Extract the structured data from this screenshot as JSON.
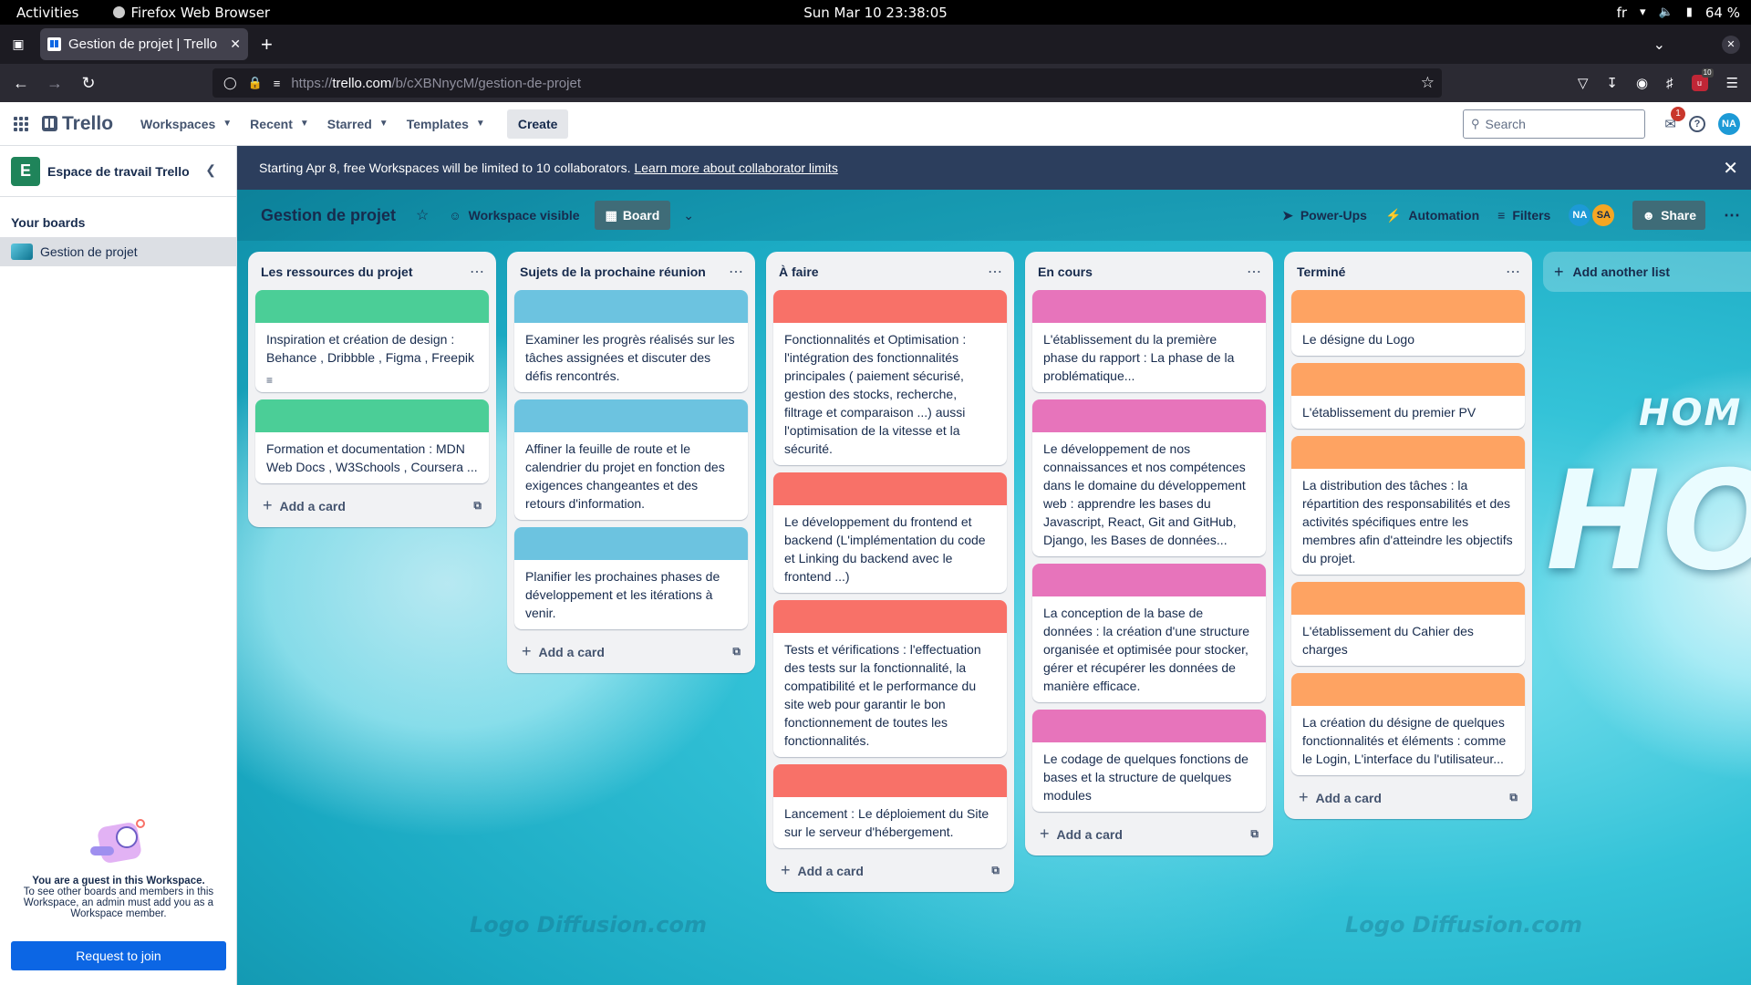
{
  "os": {
    "activities": "Activities",
    "app_name": "Firefox Web Browser",
    "clock": "Sun Mar 10  23:38:05",
    "lang": "fr",
    "battery": "64 %"
  },
  "browser": {
    "tab_title": "Gestion de projet | Trello",
    "url_prefix": "https://",
    "url_host": "trello.com",
    "url_path": "/b/cXBNnycM/gestion-de-projet",
    "ext_badge": "10"
  },
  "header": {
    "logo": "Trello",
    "menu": [
      "Workspaces",
      "Recent",
      "Starred",
      "Templates"
    ],
    "create": "Create",
    "search_placeholder": "Search",
    "notif_count": "1",
    "avatar": "NA"
  },
  "banner": {
    "text": "Starting Apr 8, free Workspaces will be limited to 10 collaborators.",
    "link": "Learn more about collaborator limits"
  },
  "sidebar": {
    "workspace_initial": "E",
    "workspace_name": "Espace de travail Trello",
    "your_boards": "Your boards",
    "boards": [
      "Gestion de projet"
    ],
    "guest_title": "You are a guest in this Workspace.",
    "guest_text": "To see other boards and members in this Workspace, an admin must add you as a Workspace member.",
    "join_button": "Request to join"
  },
  "board": {
    "title": "Gestion de projet",
    "visibility": "Workspace visible",
    "view": "Board",
    "powerups": "Power-Ups",
    "automation": "Automation",
    "filters": "Filters",
    "members": [
      "NA",
      "SA"
    ],
    "share": "Share",
    "add_card": "Add a card",
    "add_list": "Add another list",
    "background_text": [
      "HOM",
      "HO"
    ],
    "watermark": "Logo Diffusion.com",
    "colors": {
      "green": "#4bce97",
      "blue": "#6cc3e0",
      "red": "#f87168",
      "pink": "#e774bb",
      "orange": "#fea362"
    },
    "lists": [
      {
        "title": "Les ressources du projet",
        "cards": [
          {
            "cover": "#4bce97",
            "text": "Inspiration et création de design : Behance , Dribbble , Figma , Freepik",
            "has_description": true
          },
          {
            "cover": "#4bce97",
            "text": "Formation et documentation : MDN Web Docs , W3Schools , Coursera ..."
          }
        ]
      },
      {
        "title": "Sujets de la prochaine réunion",
        "cards": [
          {
            "cover": "#6cc3e0",
            "text": "Examiner les progrès réalisés sur les tâches assignées et discuter des défis rencontrés."
          },
          {
            "cover": "#6cc3e0",
            "text": "Affiner la feuille de route et le calendrier du projet en fonction des exigences changeantes et des retours d'information."
          },
          {
            "cover": "#6cc3e0",
            "text": "Planifier les prochaines phases de développement et les itérations à venir."
          }
        ]
      },
      {
        "title": "À faire",
        "cards": [
          {
            "cover": "#f87168",
            "text": "Fonctionnalités et Optimisation : l'intégration des fonctionnalités principales ( paiement sécurisé, gestion des stocks, recherche, filtrage et comparaison ...) aussi l'optimisation de la vitesse et la sécurité."
          },
          {
            "cover": "#f87168",
            "text": "Le développement du frontend et backend (L'implémentation du code et Linking du backend avec le frontend ...)"
          },
          {
            "cover": "#f87168",
            "text": "Tests et vérifications : l'effectuation des tests sur la fonctionnalité, la compatibilité et le performance du site web pour garantir le bon fonctionnement de toutes les fonctionnalités."
          },
          {
            "cover": "#f87168",
            "text": "Lancement : Le déploiement du Site sur le serveur d'hébergement."
          }
        ]
      },
      {
        "title": "En cours",
        "cards": [
          {
            "cover": "#e774bb",
            "text": "L'établissement du la première phase du rapport : La phase de la problématique..."
          },
          {
            "cover": "#e774bb",
            "text": "Le développement de nos connaissances et nos compétences dans le domaine du développement web : apprendre les bases du Javascript, React, Git and GitHub, Django, les Bases de données..."
          },
          {
            "cover": "#e774bb",
            "text": "La conception de la base de données : la création d'une structure organisée et optimisée pour stocker, gérer et récupérer les données de manière efficace."
          },
          {
            "cover": "#e774bb",
            "text": "Le codage de quelques fonctions de bases et la structure de quelques modules"
          }
        ]
      },
      {
        "title": "Terminé",
        "cards": [
          {
            "cover": "#fea362",
            "text": "Le désigne du Logo"
          },
          {
            "cover": "#fea362",
            "text": "L'établissement du premier PV"
          },
          {
            "cover": "#fea362",
            "text": "La distribution des tâches : la répartition des responsabilités et des activités spécifiques entre les membres afin d'atteindre les objectifs du projet."
          },
          {
            "cover": "#fea362",
            "text": "L'établissement du Cahier des charges"
          },
          {
            "cover": "#fea362",
            "text": "La création du désigne de quelques fonctionnalités et éléments : comme le Login, L'interface du l'utilisateur..."
          }
        ]
      }
    ]
  }
}
